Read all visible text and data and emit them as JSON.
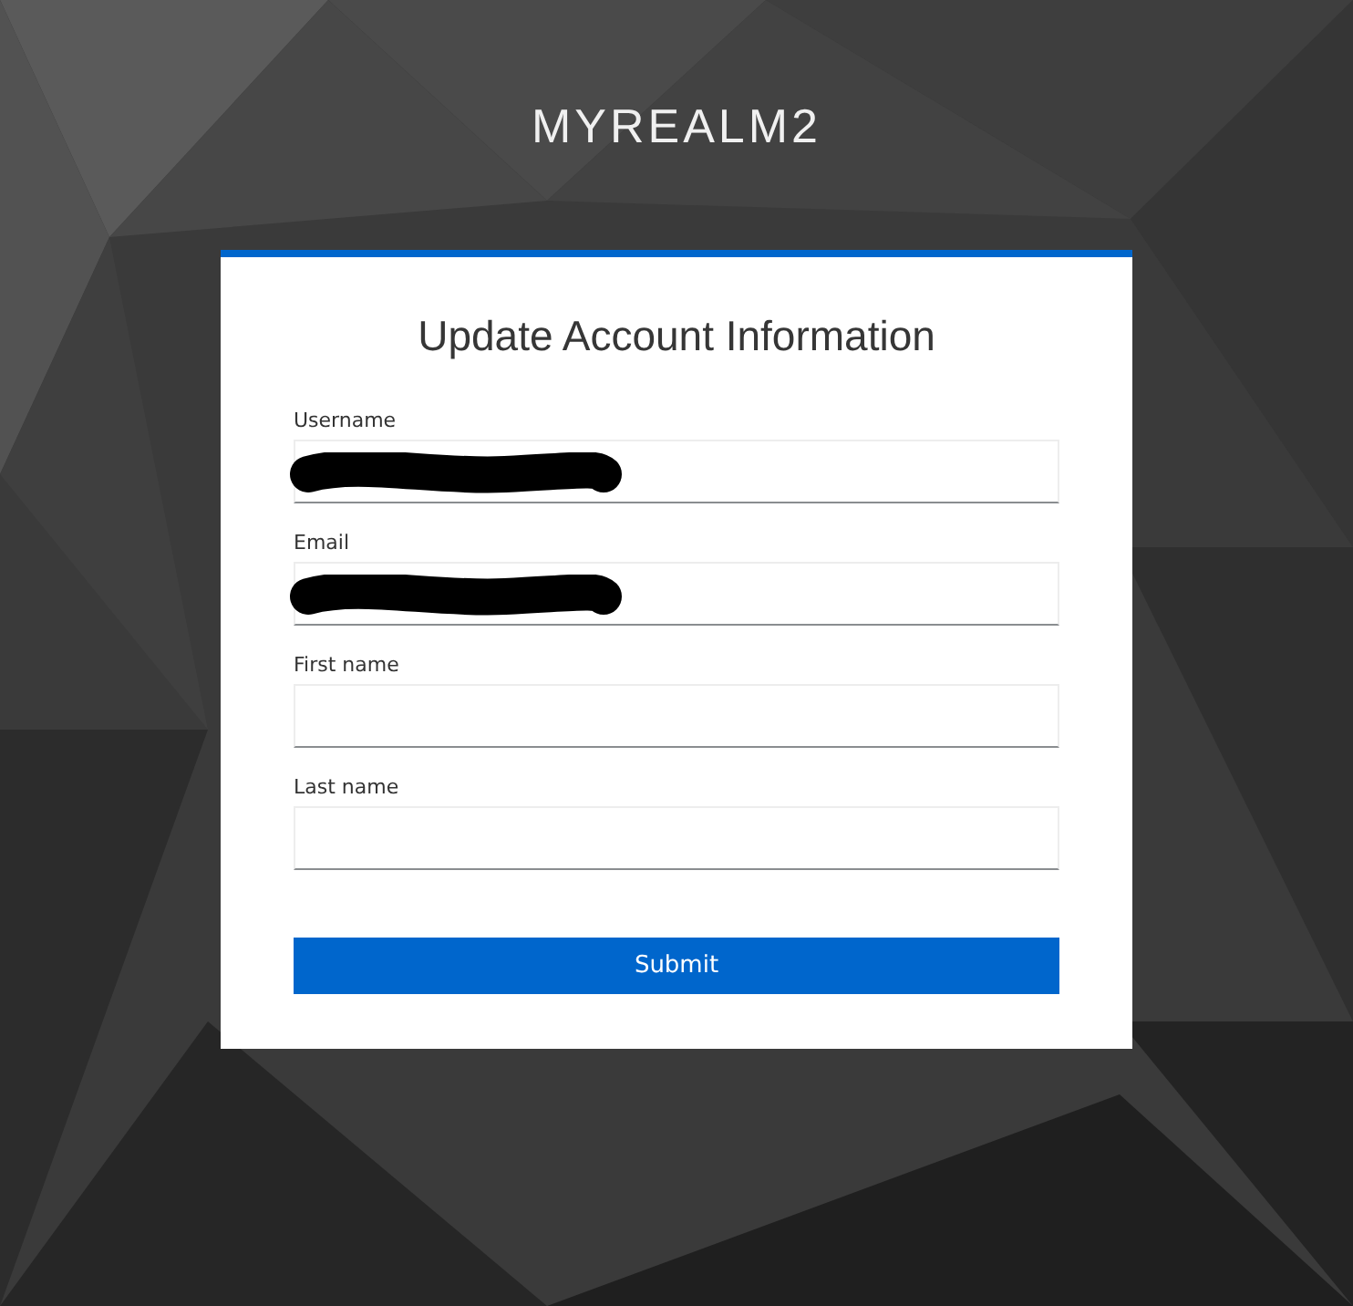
{
  "realm_title": "MYREALM2",
  "form": {
    "heading": "Update Account Information",
    "fields": [
      {
        "label": "Username",
        "redacted": true
      },
      {
        "label": "Email",
        "redacted": true
      },
      {
        "label": "First name",
        "redacted": false
      },
      {
        "label": "Last name",
        "redacted": false
      }
    ],
    "submit": "Submit"
  }
}
